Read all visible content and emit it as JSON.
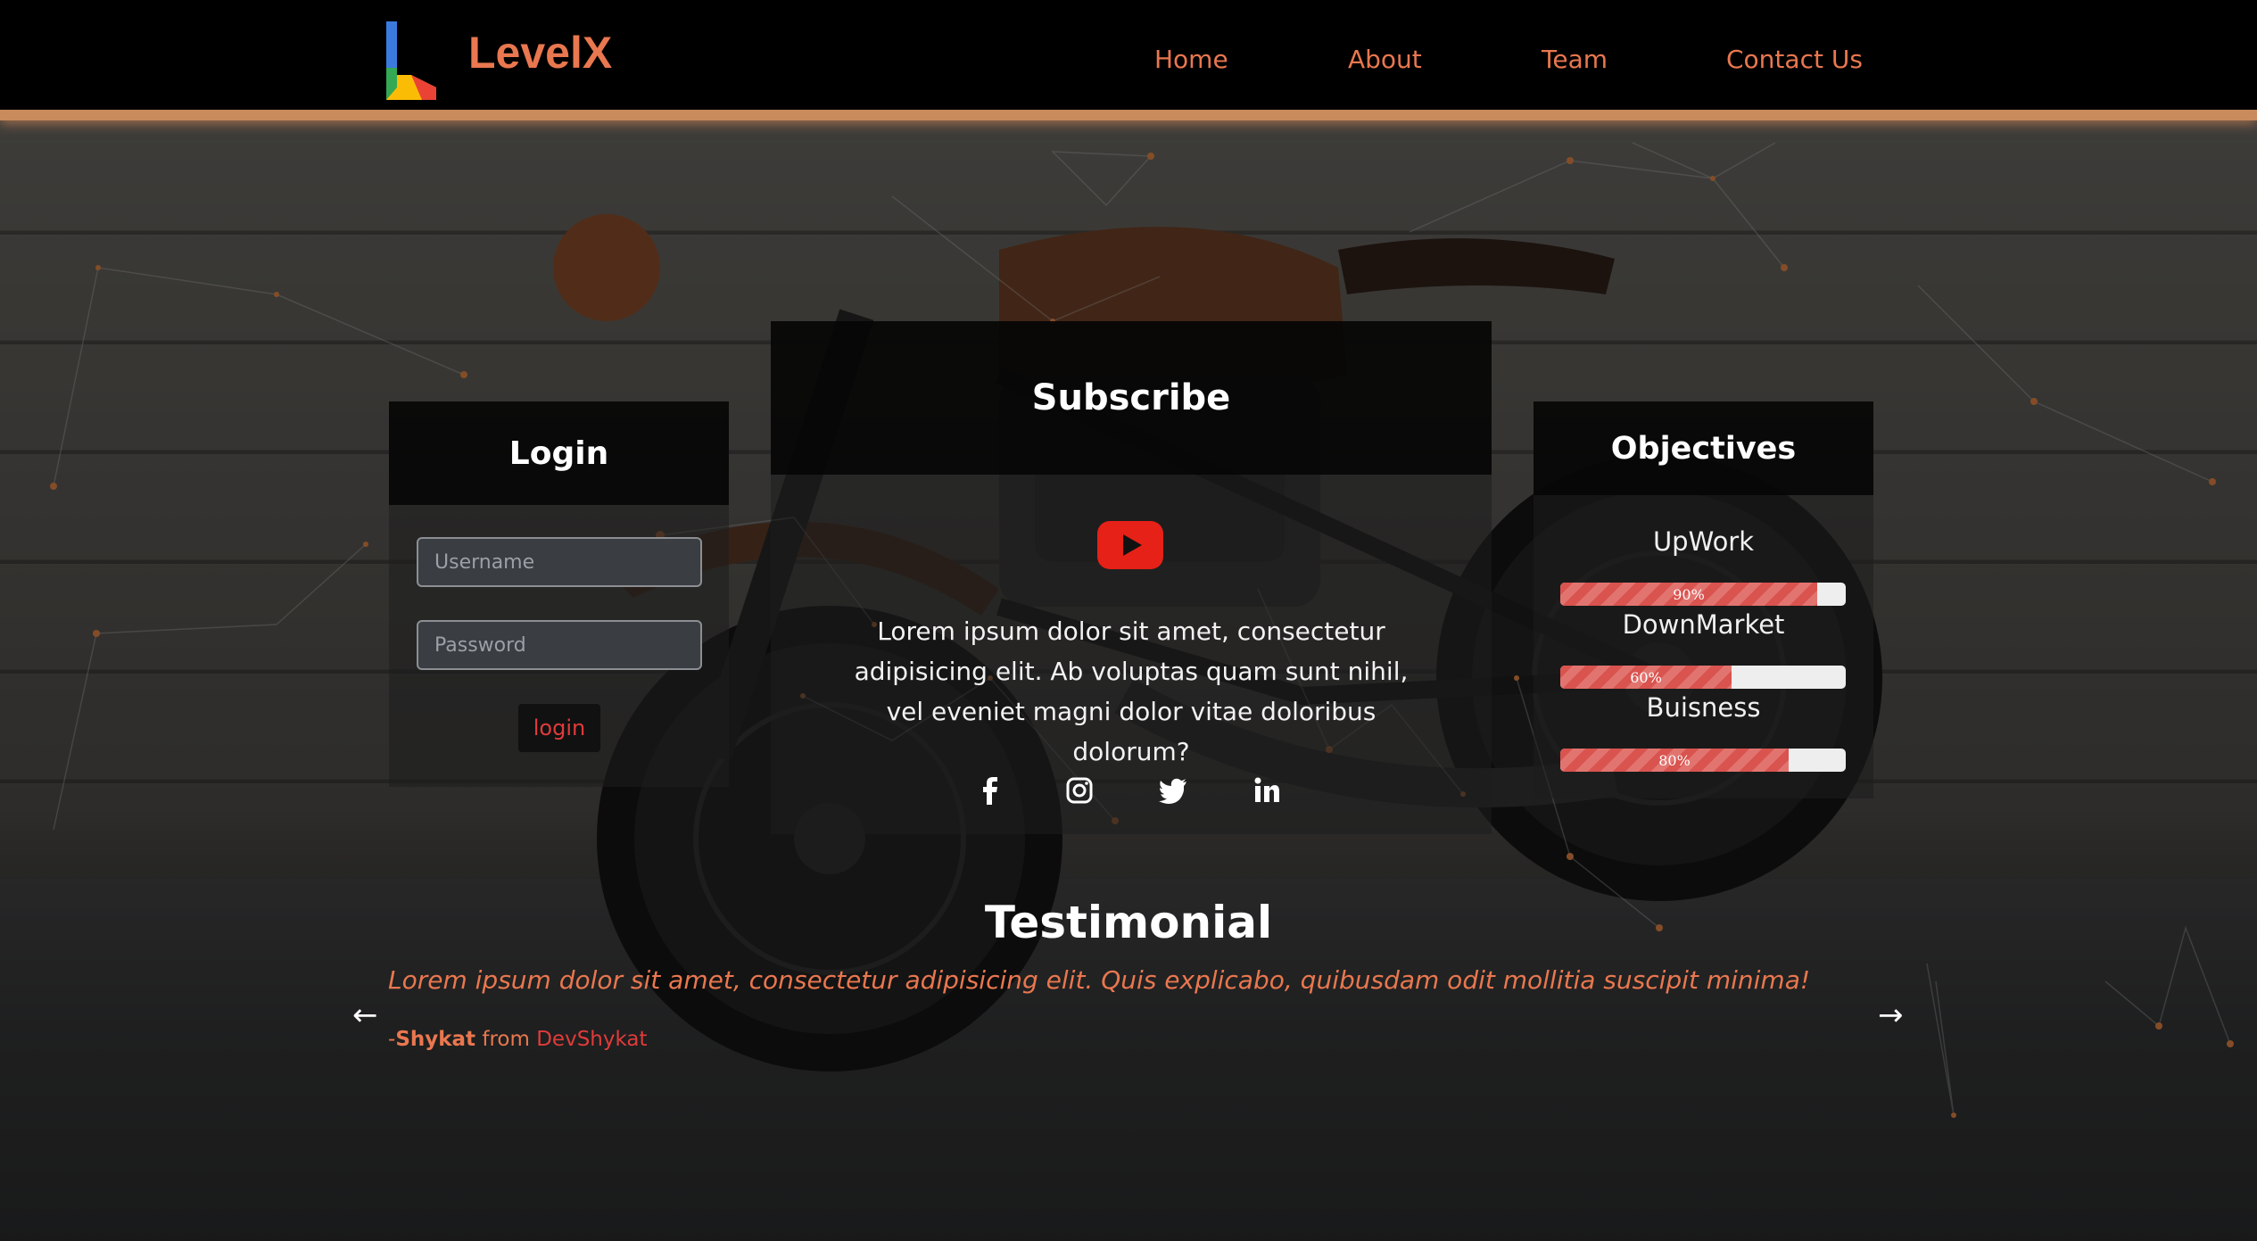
{
  "brand": {
    "name": "LevelX",
    "accent": "#e9774f"
  },
  "nav": {
    "items": [
      {
        "label": "Home"
      },
      {
        "label": "About"
      },
      {
        "label": "Team"
      },
      {
        "label": "Contact Us"
      }
    ]
  },
  "login": {
    "title": "Login",
    "username_placeholder": "Username",
    "password_placeholder": "Password",
    "button_label": "login"
  },
  "subscribe": {
    "title": "Subscribe",
    "icon": "youtube-icon",
    "text": "Lorem ipsum dolor sit amet, consectetur adipisicing elit. Ab voluptas quam sunt nihil, vel eveniet magni dolor vitae doloribus dolorum?",
    "socials": [
      "facebook-icon",
      "instagram-icon",
      "twitter-icon",
      "linkedin-icon"
    ]
  },
  "objectives": {
    "title": "Objectives",
    "items": [
      {
        "label": "UpWork",
        "percent": 90,
        "percent_label": "90%"
      },
      {
        "label": "DownMarket",
        "percent": 60,
        "percent_label": "60%"
      },
      {
        "label": "Buisness",
        "percent": 80,
        "percent_label": "80%"
      }
    ],
    "bar_color": "#d9534f"
  },
  "testimonial": {
    "title": "Testimonial",
    "quote": "Lorem ipsum dolor sit amet, consectetur adipisicing elit. Quis explicabo, quibusdam odit mollitia suscipit minima!",
    "author_prefix": "-",
    "author_name": "Shykat",
    "author_from": " from ",
    "author_company": "DevShykat",
    "prev_arrow": "←",
    "next_arrow": "→"
  }
}
